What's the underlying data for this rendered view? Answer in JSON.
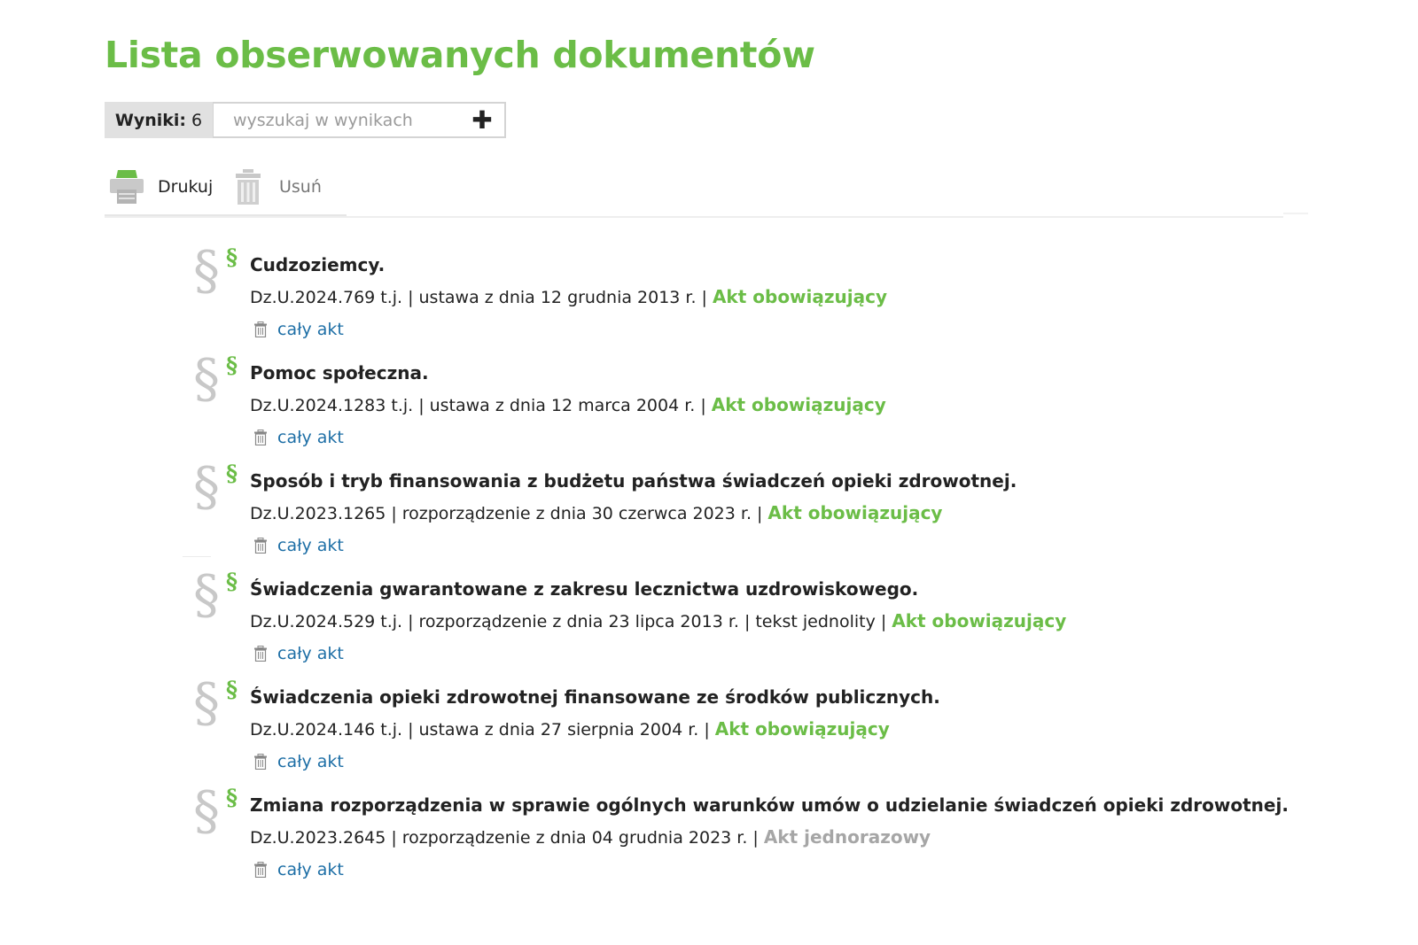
{
  "title": "Lista obserwowanych dokumentów",
  "results": {
    "label": "Wyniki:",
    "count": "6"
  },
  "search": {
    "placeholder": "wyszukaj w wynikach",
    "value": "",
    "add_icon": "plus-icon"
  },
  "toolbar": {
    "print_label": "Drukuj",
    "print_icon": "printer-icon",
    "delete_label": "Usuń",
    "delete_icon": "trash-icon"
  },
  "colors": {
    "accent": "#6bbd47",
    "link": "#1e6fa6",
    "muted": "#a6a6a6"
  },
  "documents": [
    {
      "title": "Cudzoziemcy.",
      "ref": "Dz.U.2024.769 t.j.",
      "desc": "ustawa z dnia 12 grudnia 2013 r.",
      "extra": "",
      "status": "Akt obowiązujący",
      "status_type": "active",
      "link": "cały akt"
    },
    {
      "title": "Pomoc społeczna.",
      "ref": "Dz.U.2024.1283 t.j.",
      "desc": "ustawa z dnia 12 marca 2004 r.",
      "extra": "",
      "status": "Akt obowiązujący",
      "status_type": "active",
      "link": "cały akt"
    },
    {
      "title": "Sposób i tryb finansowania z budżetu państwa świadczeń opieki zdrowotnej.",
      "ref": "Dz.U.2023.1265",
      "desc": "rozporządzenie z dnia 30 czerwca 2023 r.",
      "extra": "",
      "status": "Akt obowiązujący",
      "status_type": "active",
      "link": "cały akt"
    },
    {
      "title": "Świadczenia gwarantowane z zakresu lecznictwa uzdrowiskowego.",
      "ref": "Dz.U.2024.529 t.j.",
      "desc": "rozporządzenie z dnia 23 lipca 2013 r.",
      "extra": "tekst jednolity",
      "status": "Akt obowiązujący",
      "status_type": "active",
      "link": "cały akt"
    },
    {
      "title": "Świadczenia opieki zdrowotnej finansowane ze środków publicznych.",
      "ref": "Dz.U.2024.146 t.j.",
      "desc": "ustawa z dnia 27 sierpnia 2004 r.",
      "extra": "",
      "status": "Akt obowiązujący",
      "status_type": "active",
      "link": "cały akt"
    },
    {
      "title": "Zmiana rozporządzenia w sprawie ogólnych warunków umów o udzielanie świadczeń opieki zdrowotnej.",
      "ref": "Dz.U.2023.2645",
      "desc": "rozporządzenie z dnia 04 grudnia 2023 r.",
      "extra": "",
      "status": "Akt jednorazowy",
      "status_type": "once",
      "link": "cały akt"
    }
  ]
}
